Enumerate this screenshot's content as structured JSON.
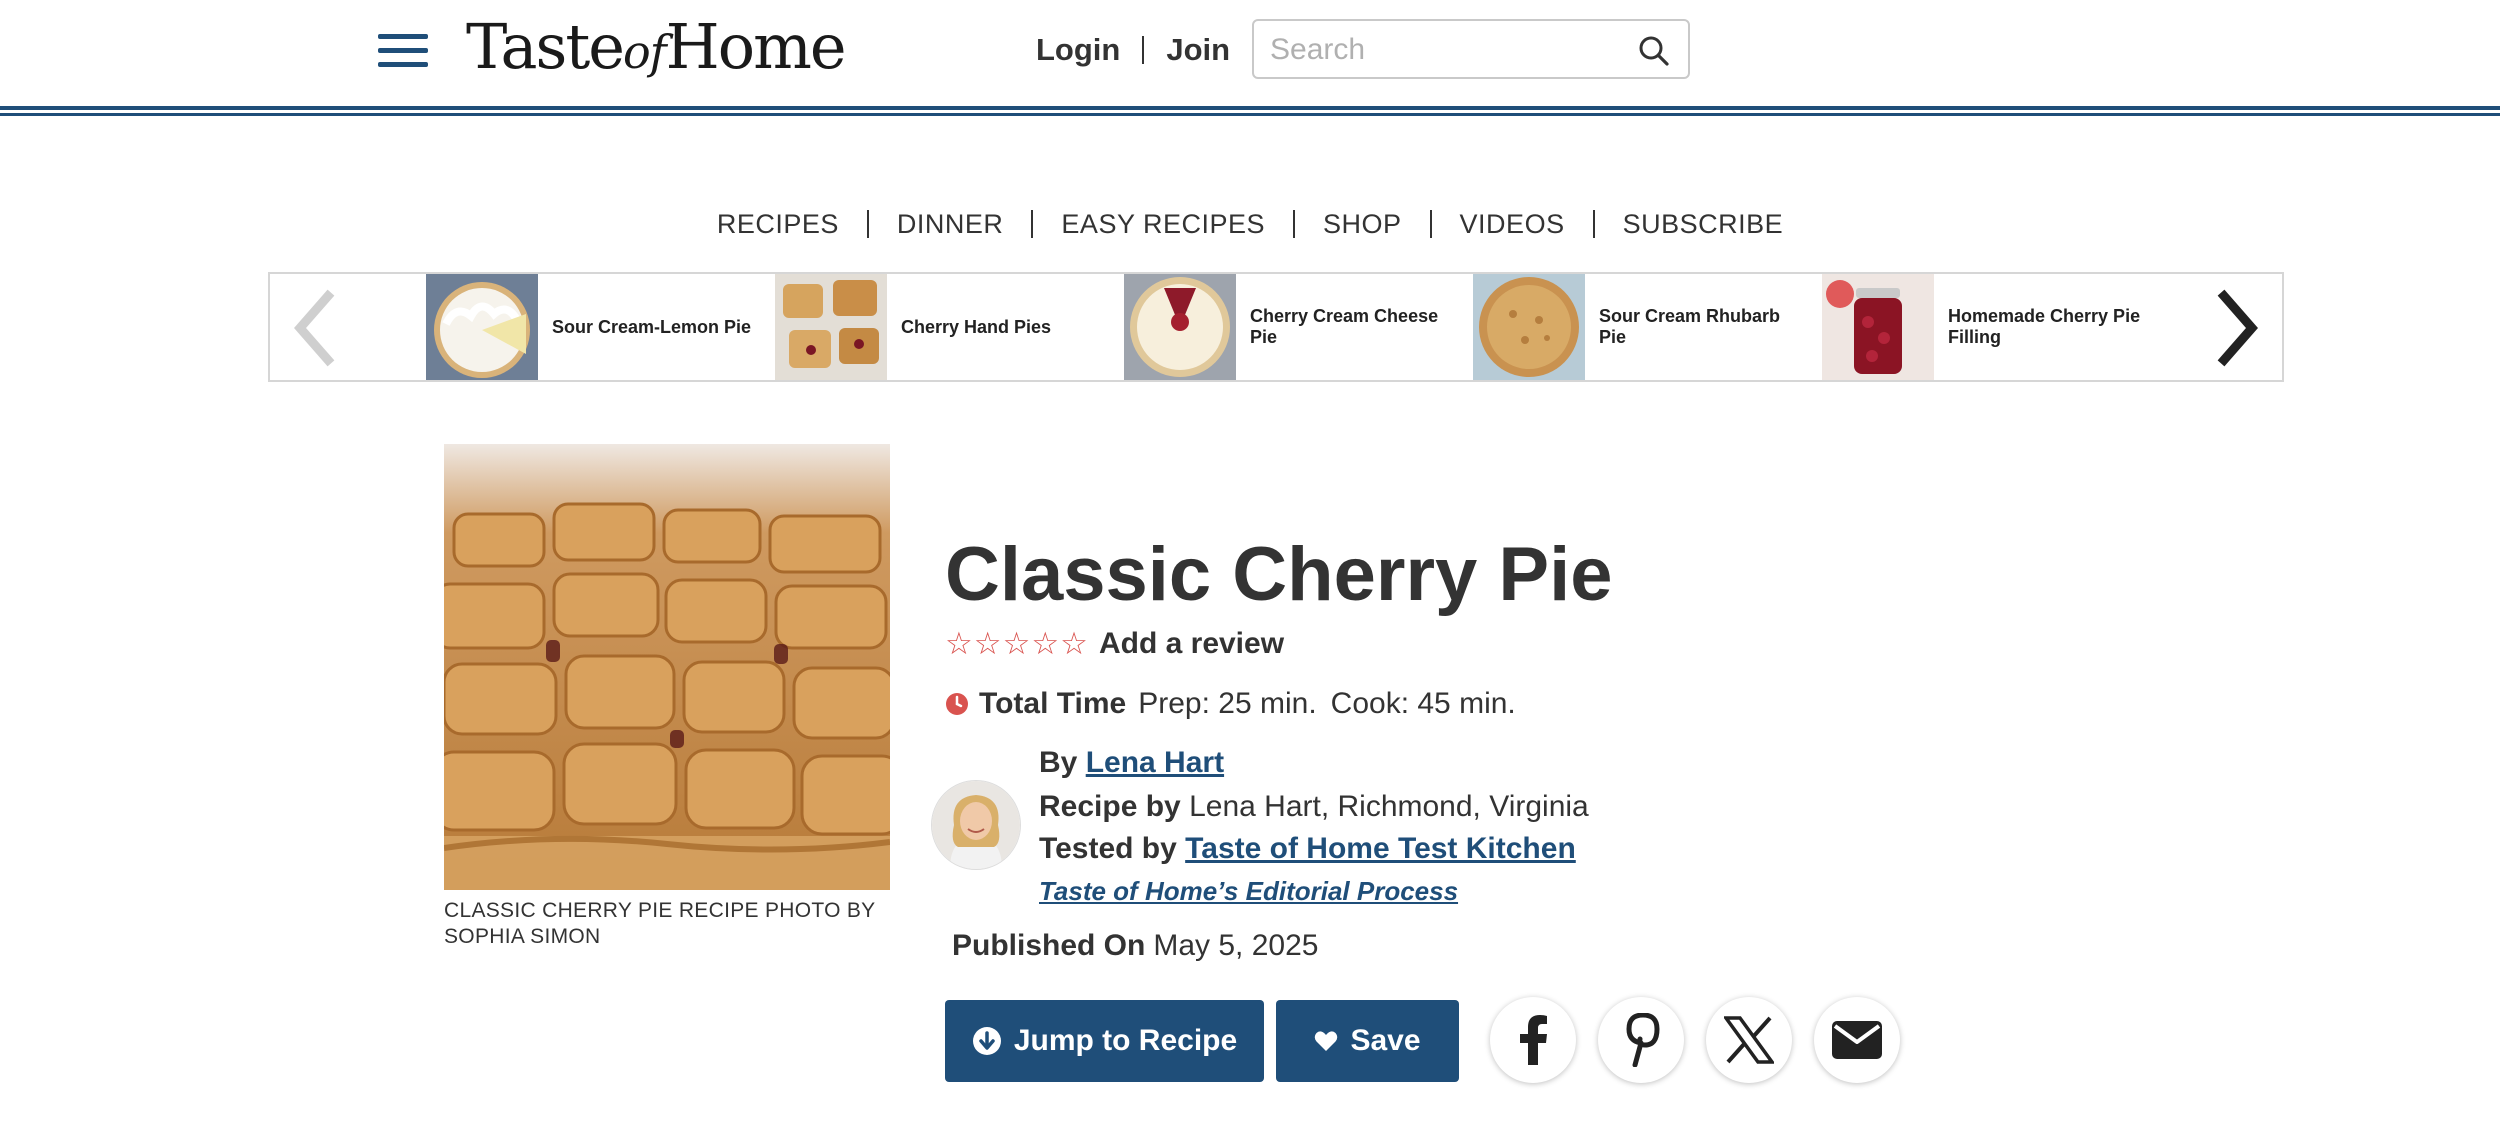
{
  "header": {
    "logo": {
      "main_a": "Taste",
      "of": "of",
      "main_b": "Home"
    },
    "login_label": "Login",
    "join_label": "Join",
    "search": {
      "placeholder": "Search",
      "value": ""
    }
  },
  "nav": {
    "items": [
      "RECIPES",
      "DINNER",
      "EASY RECIPES",
      "SHOP",
      "VIDEOS",
      "SUBSCRIBE"
    ]
  },
  "carousel": {
    "items": [
      {
        "label": "Sour Cream-Lemon Pie",
        "icon": "pie-thumbnail"
      },
      {
        "label": "Cherry Hand Pies",
        "icon": "pie-thumbnail"
      },
      {
        "label": "Cherry Cream Cheese Pie",
        "icon": "pie-thumbnail"
      },
      {
        "label": "Sour Cream Rhubarb Pie",
        "icon": "pie-thumbnail"
      },
      {
        "label": "Homemade Cherry Pie Filling",
        "icon": "jar-thumbnail"
      }
    ]
  },
  "hero": {
    "caption": "CLASSIC CHERRY PIE RECIPE PHOTO BY SOPHIA SIMON"
  },
  "recipe": {
    "title": "Classic Cherry Pie",
    "stars": "☆☆☆☆☆",
    "add_review": "Add a review",
    "total_time_label": "Total Time",
    "prep": "Prep: 25 min.",
    "cook": "Cook: 45 min.",
    "by_label": "By",
    "author": "Lena Hart",
    "recipe_by_label": "Recipe by",
    "recipe_by_value": "Lena Hart, Richmond, Virginia",
    "tested_by_label": "Tested by",
    "tested_by_value": "Taste of Home Test Kitchen",
    "editorial_process": "Taste of Home’s Editorial Process",
    "published_label": "Published On",
    "published_date": "May 5, 2025"
  },
  "actions": {
    "jump_label": "Jump to Recipe",
    "save_label": "Save"
  },
  "colors": {
    "brand_navy": "#1f4e79",
    "star_red": "#d9534f"
  }
}
